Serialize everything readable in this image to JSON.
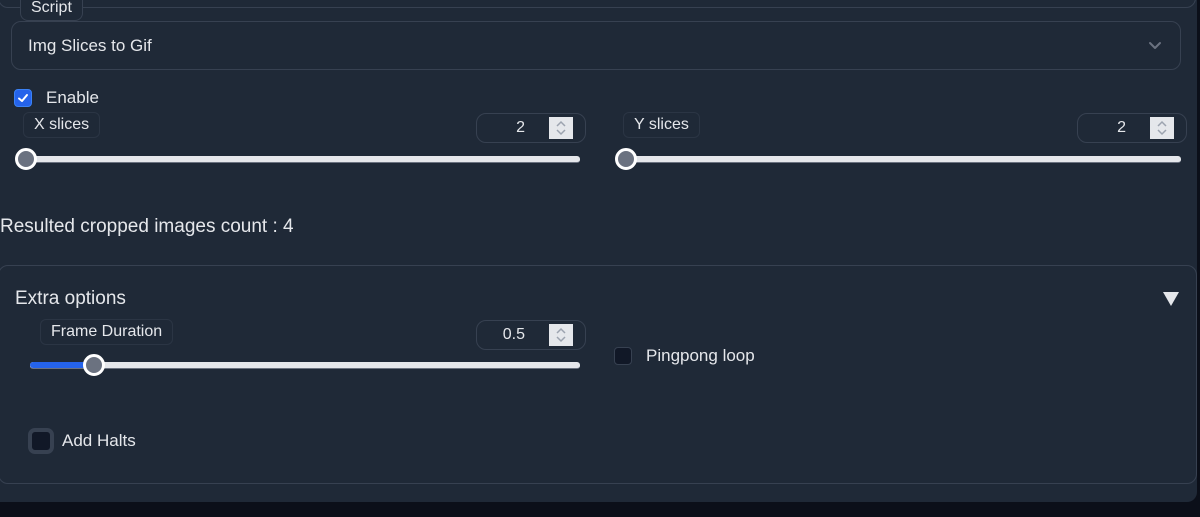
{
  "script": {
    "label": "Script",
    "selected": "Img Slices to Gif",
    "chevron_icon": "chevron-down-icon"
  },
  "enable": {
    "label": "Enable",
    "checked": true
  },
  "x_slices": {
    "label": "X slices",
    "value": "2",
    "fraction": 0.0
  },
  "y_slices": {
    "label": "Y slices",
    "value": "2",
    "fraction": 0.0
  },
  "result_text": "Resulted cropped images count : 4",
  "extra_options": {
    "title": "Extra options",
    "toggle_icon": "triangle-down-icon",
    "frame_duration": {
      "label": "Frame Duration",
      "value": "0.5",
      "fraction": 0.117
    },
    "pingpong_loop": {
      "label": "Pingpong loop",
      "checked": false
    },
    "add_halts": {
      "label": "Add Halts",
      "checked": false
    }
  },
  "colors": {
    "accent": "#2563eb",
    "panel_bg": "#1f2937",
    "page_bg": "#0b0f19",
    "border": "#374151"
  }
}
